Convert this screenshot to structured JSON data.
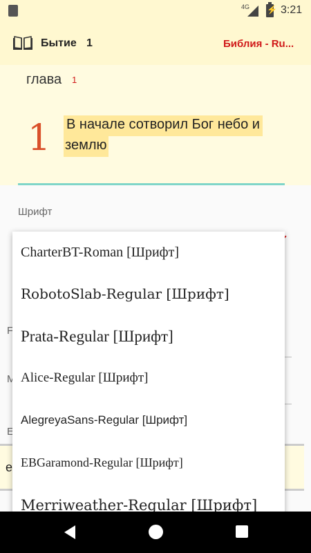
{
  "status_bar": {
    "network": "4G",
    "time": "3:21"
  },
  "app_bar": {
    "book": "Бытие",
    "chapter": "1",
    "bible_name": "Библия - Ru...",
    "accent_color": "#d01919"
  },
  "content": {
    "chapter_label": "глава",
    "chapter_number": "1",
    "dropcap": "1",
    "verse_line1": "В начале сотворил Бог небо и",
    "verse_line2": "землю",
    "highlight_color": "#ffe89a"
  },
  "dialog": {
    "label": "Шрифт",
    "background_field_text": "е",
    "background_letters": [
      "F",
      "M",
      "E"
    ]
  },
  "dropdown": {
    "items": [
      "CharterBT-Roman [Шрифт]",
      "RobotoSlab-Regular [Шрифт]",
      "Prata-Regular [Шрифт]",
      "Alice-Regular [Шрифт]",
      "AlegreyaSans-Regular [Шрифт]",
      "EBGaramond-Regular [Шрифт]",
      "Merriweather-Regular [Шрифт]"
    ]
  }
}
